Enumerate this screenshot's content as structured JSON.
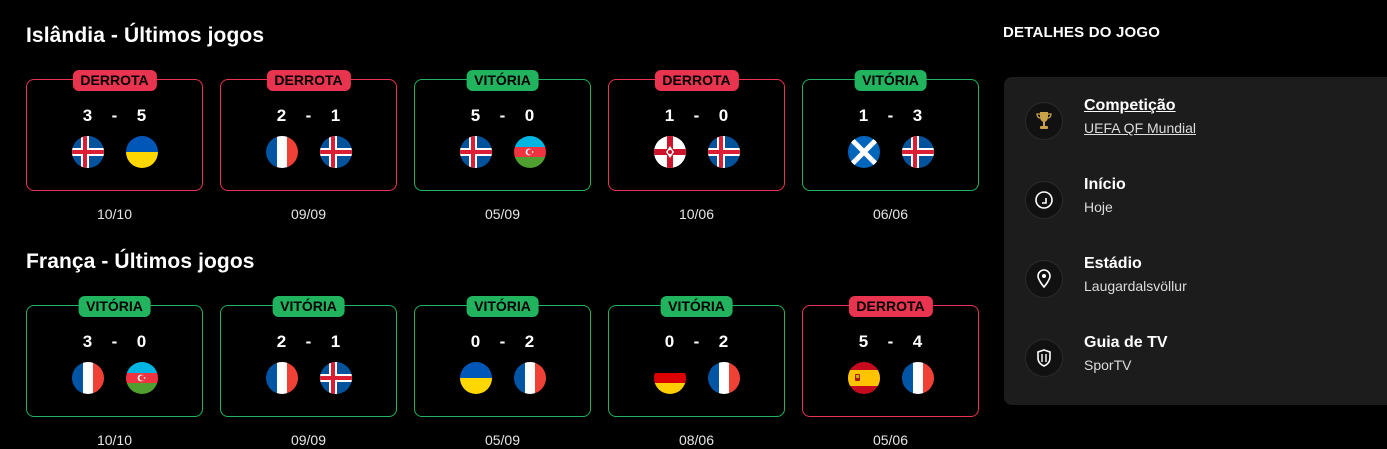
{
  "sections": [
    {
      "title": "Islândia - Últimos jogos",
      "matches": [
        {
          "result": "DERROTA",
          "outcome": "loss",
          "home_score": "3",
          "away_score": "5",
          "home_flag": "iceland-flag",
          "away_flag": "ukraine-flag",
          "date": "10/10"
        },
        {
          "result": "DERROTA",
          "outcome": "loss",
          "home_score": "2",
          "away_score": "1",
          "home_flag": "france-flag",
          "away_flag": "iceland-flag",
          "date": "09/09"
        },
        {
          "result": "VITÓRIA",
          "outcome": "win",
          "home_score": "5",
          "away_score": "0",
          "home_flag": "iceland-flag",
          "away_flag": "azerbaijan-flag",
          "date": "05/09"
        },
        {
          "result": "DERROTA",
          "outcome": "loss",
          "home_score": "1",
          "away_score": "0",
          "home_flag": "northern-ireland-flag",
          "away_flag": "iceland-flag",
          "date": "10/06"
        },
        {
          "result": "VITÓRIA",
          "outcome": "win",
          "home_score": "1",
          "away_score": "3",
          "home_flag": "scotland-flag",
          "away_flag": "iceland-flag",
          "date": "06/06"
        }
      ]
    },
    {
      "title": "França - Últimos jogos",
      "matches": [
        {
          "result": "VITÓRIA",
          "outcome": "win",
          "home_score": "3",
          "away_score": "0",
          "home_flag": "france-flag",
          "away_flag": "azerbaijan-flag",
          "date": "10/10"
        },
        {
          "result": "VITÓRIA",
          "outcome": "win",
          "home_score": "2",
          "away_score": "1",
          "home_flag": "france-flag",
          "away_flag": "iceland-flag",
          "date": "09/09"
        },
        {
          "result": "VITÓRIA",
          "outcome": "win",
          "home_score": "0",
          "away_score": "2",
          "home_flag": "ukraine-flag",
          "away_flag": "france-flag",
          "date": "05/09"
        },
        {
          "result": "VITÓRIA",
          "outcome": "win",
          "home_score": "0",
          "away_score": "2",
          "home_flag": "germany-flag",
          "away_flag": "france-flag",
          "date": "08/06"
        },
        {
          "result": "DERROTA",
          "outcome": "loss",
          "home_score": "5",
          "away_score": "4",
          "home_flag": "spain-flag",
          "away_flag": "france-flag",
          "date": "05/06"
        }
      ]
    }
  ],
  "score_separator": "-",
  "details": {
    "title": "DETALHES DO JOGO",
    "items": [
      {
        "icon": "trophy-icon",
        "label": "Competição",
        "value": "UEFA QF Mundial"
      },
      {
        "icon": "clock-icon",
        "label": "Início",
        "value": "Hoje"
      },
      {
        "icon": "location-pin-icon",
        "label": "Estádio",
        "value": "Laugardalsvöllur"
      },
      {
        "icon": "tv-shield-icon",
        "label": "Guia de TV",
        "value": "SporTV"
      }
    ]
  },
  "colors": {
    "win": "#22b35e",
    "loss": "#e8344e",
    "panel": "#1c1c1c",
    "background": "#000000"
  }
}
